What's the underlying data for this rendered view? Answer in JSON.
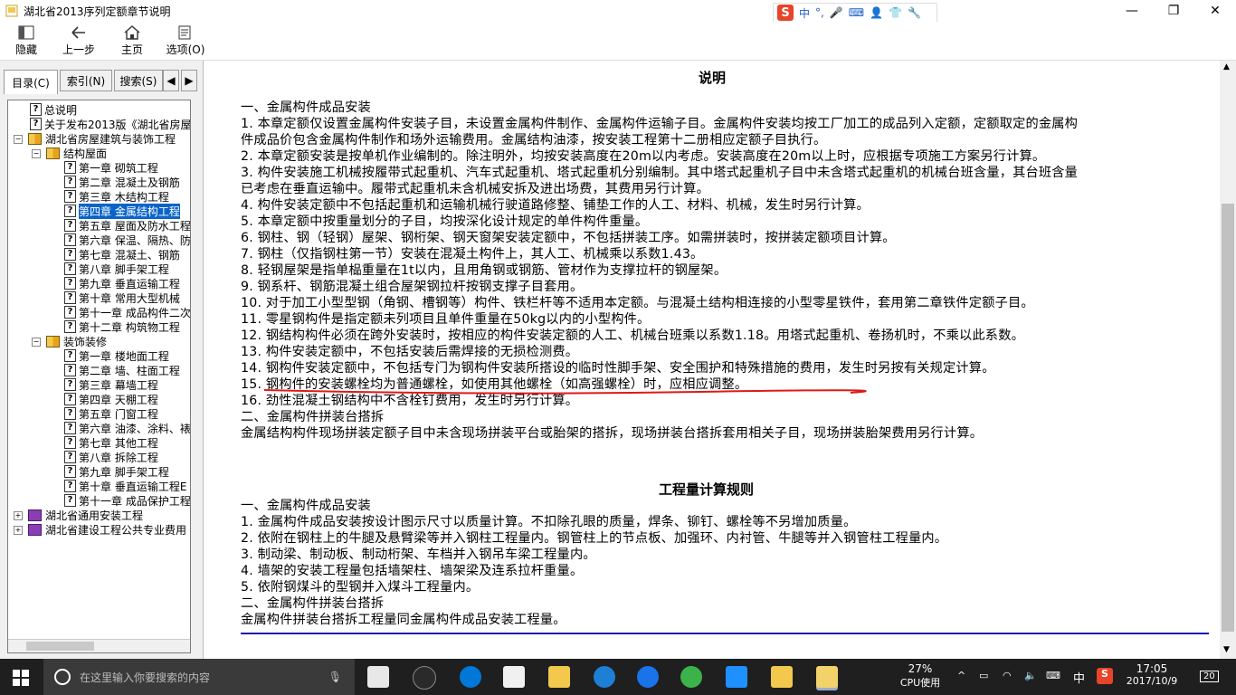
{
  "window": {
    "title": "湖北省2013序列定额章节说明"
  },
  "toolbar": {
    "hide": "隐藏",
    "back": "上一步",
    "home": "主页",
    "options": "选项(O)"
  },
  "tabs": {
    "contents": "目录(C)",
    "index": "索引(N)",
    "search": "搜索(S)"
  },
  "tree": [
    "总说明",
    "关于发布2013版《湖北省房屋",
    "湖北省房屋建筑与装饰工程",
    "结构屋面",
    "第一章 砌筑工程",
    "第二章 混凝土及钢筋",
    "第三章 木结构工程",
    "第四章 金属结构工程",
    "第五章 屋面及防水工程",
    "第六章 保温、隔热、防",
    "第七章 混凝土、钢筋",
    "第八章 脚手架工程",
    "第九章 垂直运输工程",
    "第十章 常用大型机械",
    "第十一章 成品构件二次",
    "第十二章 构筑物工程",
    "装饰装修",
    "第一章 楼地面工程",
    "第二章 墙、柱面工程",
    "第三章 幕墙工程",
    "第四章 天棚工程",
    "第五章 门窗工程",
    "第六章 油漆、涂料、裱",
    "第七章 其他工程",
    "第八章 拆除工程",
    "第九章 脚手架工程",
    "第十章 垂直运输工程E",
    "第十一章 成品保护工程",
    "湖北省通用安装工程",
    "湖北省建设工程公共专业费用"
  ],
  "content": {
    "title": "说明",
    "lines": [
      "一、金属构件成品安装",
      "1. 本章定额仅设置金属构件安装子目，未设置金属构件制作、金属构件运输子目。金属构件安装均按工厂加工的成品列入定额，定额取定的金属构",
      "件成品价包含金属构件制作和场外运输费用。金属结构油漆，按安装工程第十二册相应定额子目执行。",
      "2. 本章定额安装是按单机作业编制的。除注明外，均按安装高度在20m以内考虑。安装高度在20m以上时，应根据专项施工方案另行计算。",
      "3. 构件安装施工机械按履带式起重机、汽车式起重机、塔式起重机分别编制。其中塔式起重机子目中未含塔式起重机的机械台班含量，其台班含量",
      "已考虑在垂直运输中。履带式起重机未含机械安拆及进出场费，其费用另行计算。",
      "4. 构件安装定额中不包括起重机和运输机械行驶道路修整、铺垫工作的人工、材料、机械，发生时另行计算。",
      "5. 本章定额中按重量划分的子目，均按深化设计规定的单件构件重量。",
      "6. 钢柱、钢（轻钢）屋架、钢桁架、钢天窗架安装定额中，不包括拼装工序。如需拼装时，按拼装定额项目计算。",
      "7. 钢柱（仅指钢柱第一节）安装在混凝土构件上，其人工、机械乘以系数1.43。",
      "8. 轻钢屋架是指单榀重量在1t以内，且用角钢或钢筋、管材作为支撑拉杆的钢屋架。",
      "9. 钢系杆、钢筋混凝土组合屋架钢拉杆按钢支撑子目套用。",
      "10. 对于加工小型型钢（角钢、槽钢等）构件、铁栏杆等不适用本定额。与混凝土结构相连接的小型零星铁件，套用第二章铁件定额子目。",
      "11. 零星钢构件是指定额未列项目且单件重量在50kg以内的小型构件。",
      "12. 钢结构构件必须在跨外安装时，按相应的构件安装定额的人工、机械台班乘以系数1.18。用塔式起重机、卷扬机时，不乘以此系数。",
      "13. 构件安装定额中，不包括安装后需焊接的无损检测费。",
      "14. 钢构件安装定额中，不包括专门为钢构件安装所搭设的临时性脚手架、安全围护和特殊措施的费用，发生时另按有关规定计算。",
      "15. 钢构件的安装螺栓均为普通螺栓，如使用其他螺栓（如高强螺栓）时，应相应调整。",
      "16. 劲性混凝土钢结构中不含栓钉费用，发生时另行计算。",
      "二、金属构件拼装台搭拆",
      "金属结构构件现场拼装定额子目中未含现场拼装平台或胎架的搭拆，现场拼装台搭拆套用相关子目，现场拼装胎架费用另行计算。"
    ],
    "title2": "工程量计算规则",
    "lines2": [
      "一、金属构件成品安装",
      "1. 金属构件成品安装按设计图示尺寸以质量计算。不扣除孔眼的质量，焊条、铆钉、螺栓等不另增加质量。",
      "2. 依附在钢柱上的牛腿及悬臂梁等并入钢柱工程量内。钢管柱上的节点板、加强环、内衬管、牛腿等并入钢管柱工程量内。",
      "3. 制动梁、制动板、制动桁架、车档并入钢吊车梁工程量内。",
      "4. 墙架的安装工程量包括墙架柱、墙架梁及连系拉杆重量。",
      "5. 依附钢煤斗的型钢并入煤斗工程量内。",
      "二、金属构件拼装台搭拆",
      "金属构件拼装台搭拆工程量同金属构件成品安装工程量。"
    ]
  },
  "ime": {
    "lang": "中"
  },
  "taskbar": {
    "search_placeholder": "在这里输入你要搜索的内容",
    "cpu_percent": "27%",
    "cpu_label": "CPU使用",
    "ime": "中",
    "time": "17:05",
    "date": "2017/10/9",
    "notifications": "20"
  }
}
